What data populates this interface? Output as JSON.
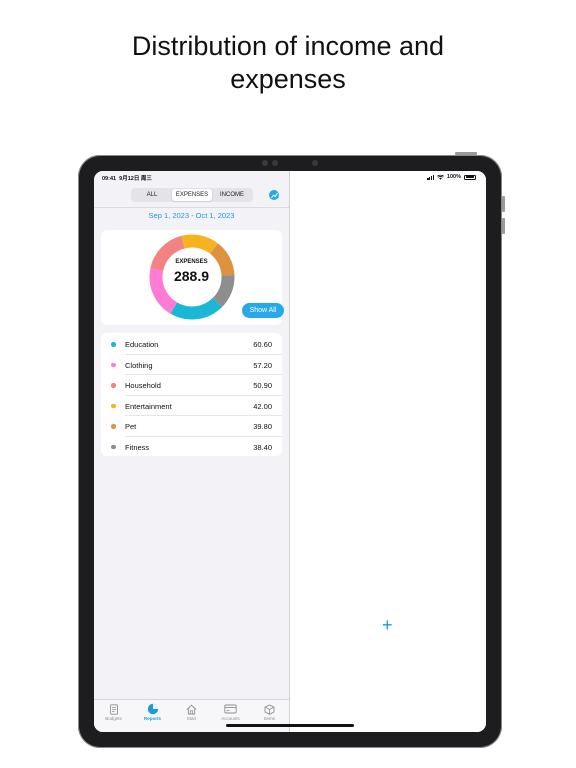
{
  "headline": {
    "line1": "Distribution of income and",
    "line2": "expenses"
  },
  "status_bar": {
    "time": "09:41",
    "date": "9月12日 周三",
    "battery": "100%"
  },
  "segment": {
    "options": [
      "ALL",
      "EXPENSES",
      "INCOME"
    ],
    "selected": "EXPENSES"
  },
  "date_range": "Sep 1, 2023  -  Oct 1, 2023",
  "summary": {
    "label": "EXPENSES",
    "total": "288.9",
    "show_all": "Show All"
  },
  "categories": [
    {
      "name": "Education",
      "value": "60.60",
      "color": "#1ab8d4"
    },
    {
      "name": "Clothing",
      "value": "57.20",
      "color": "#ff7bd6"
    },
    {
      "name": "Household",
      "value": "50.90",
      "color": "#f38282"
    },
    {
      "name": "Entertainment",
      "value": "42.00",
      "color": "#f5b320"
    },
    {
      "name": "Pet",
      "value": "39.80",
      "color": "#dd9240"
    },
    {
      "name": "Fitness",
      "value": "38.40",
      "color": "#8e8e8e"
    }
  ],
  "tabs": [
    {
      "label": "Budgets",
      "icon": "budgets-icon"
    },
    {
      "label": "Reports",
      "icon": "reports-pie-icon",
      "active": true
    },
    {
      "label": "Start",
      "icon": "start-house-icon"
    },
    {
      "label": "Accounts",
      "icon": "accounts-card-icon"
    },
    {
      "label": "Items",
      "icon": "items-box-icon"
    }
  ],
  "detail": {
    "add_symbol": "+"
  },
  "colors": {
    "accent": "#26a9e8",
    "link": "#1a9be0",
    "list_background": "#f2f2f7"
  }
}
